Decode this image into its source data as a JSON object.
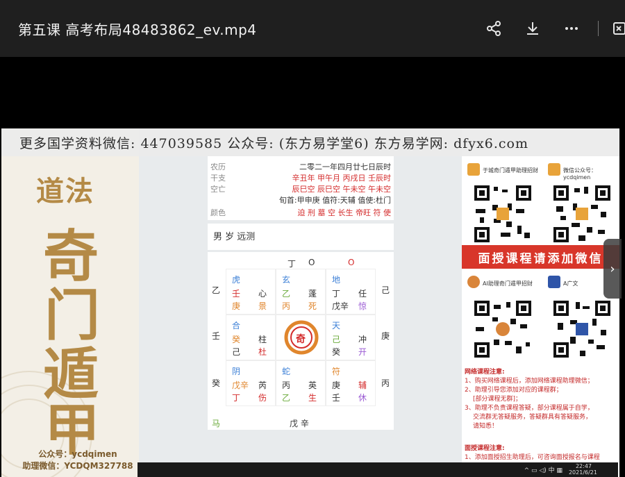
{
  "window": {
    "title": "第五课 高考布局48483862_ev.mp4",
    "icons": [
      "share-icon",
      "download-icon",
      "more-icon",
      "exit-icon"
    ]
  },
  "watermark": {
    "text": "更多国学资料微信: 447039585 公众号: (东方易学堂6) 东方易学网: dfyx6.com"
  },
  "left_panel": {
    "calligraphy_top": "道法",
    "calligraphy_main": [
      "奇",
      "门",
      "遁",
      "甲"
    ],
    "footer_public": "公众号：ycdqimen",
    "footer_assistant": "助理微信：YCDQM327788"
  },
  "info": {
    "nongli_label": "农历",
    "nongli_value": "二零二一年四月廿七日辰时",
    "ganzhi_label": "干支",
    "ganzhi_value": "辛丑年 甲午月 丙戌日 壬辰时",
    "kongwang_label": "空亡",
    "kongwang_value": "辰巳空 辰巳空 午未空 午未空",
    "xunshou_value": "旬首:甲申庚 值符:天辅 值使:杜门",
    "yanse_label": "颜色",
    "yanse_value": "迫 刑 墓 空 长生 帝旺 符 使"
  },
  "query": {
    "text": "男 岁 远测"
  },
  "board": {
    "top_row": [
      "丁",
      "O",
      "O"
    ],
    "left_col": [
      "乙",
      "壬",
      "癸"
    ],
    "right_col": [
      "己",
      "庚",
      "丙"
    ],
    "bottom_row": [
      "马",
      "戊 辛"
    ],
    "cells": [
      {
        "god": "虎",
        "a": "壬",
        "b": "心",
        "c": "庚",
        "d": "景"
      },
      {
        "god": "玄",
        "a": "乙",
        "b": "蓬",
        "c": "丙",
        "d": "死"
      },
      {
        "god": "地",
        "a": "丁",
        "b": "任",
        "c": "戊辛",
        "d": "惊"
      },
      {
        "god": "合",
        "a": "癸",
        "b": "柱",
        "c": "己",
        "d": "杜"
      },
      {
        "god": "",
        "a": "奇",
        "b": "",
        "c": "",
        "d": ""
      },
      {
        "god": "天",
        "a": "己",
        "b": "冲",
        "c": "癸",
        "d": "开"
      },
      {
        "god": "阴",
        "a": "戊辛",
        "b": "芮",
        "c": "丁",
        "d": "伤"
      },
      {
        "god": "蛇",
        "a": "丙",
        "b": "英",
        "c": "乙",
        "d": "生"
      },
      {
        "god": "符",
        "a": "庚",
        "b": "辅",
        "c": "壬",
        "d": "休"
      }
    ]
  },
  "right_panel": {
    "acct1": "于城奇门遁甲助理招财",
    "acct2": "微信公众号：ycdqimen",
    "acct3": "AI助理奇门遁甲招财",
    "acct4": "A广文",
    "banner": "面授课程请添加微信",
    "notes_title": "网络课程注意:",
    "notes": [
      "1、购买网络课程后，添加网络课程助理微信；",
      "2、助理引导您添加对应的课程群；",
      "[部分课程无群]；",
      "3、助理不负责课程答疑，部分课程属于自学，",
      "交流群无答疑服务，答疑群具有答疑服务，",
      "请知悉！"
    ],
    "notes2_title": "面授课程注意:",
    "notes2": [
      "1、添加面授招生助理后，可咨询面授报名与课程"
    ]
  },
  "taskbar": {
    "time": "22:47",
    "date": "2021/6/21"
  }
}
